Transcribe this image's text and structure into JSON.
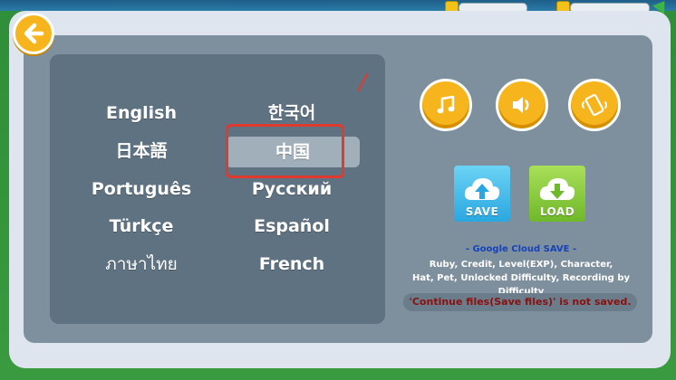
{
  "languages": {
    "english": "English",
    "korean": "한국어",
    "japanese": "日本語",
    "chinese": "中国",
    "portuguese": "Português",
    "russian": "Русский",
    "turkish": "Türkçe",
    "spanish": "Español",
    "thai": "ภาษาไทย",
    "french": "French",
    "selected": "chinese"
  },
  "cloud": {
    "save_label": "SAVE",
    "load_label": "LOAD",
    "title": "- Google Cloud SAVE -",
    "desc_line1": "Ruby, Credit, Level(EXP), Character,",
    "desc_line2": "Hat, Pet, Unlocked Difficulty, Recording by Difficulty",
    "notice": "'Continue  files(Save files)' is not saved."
  },
  "icons": {
    "back": "back-arrow-icon",
    "music": "music-note-icon",
    "sound": "speaker-icon",
    "vibration": "vibrate-phone-icon",
    "save": "cloud-upload-icon",
    "load": "cloud-download-icon"
  },
  "colors": {
    "button_yellow": "#f7b51d",
    "highlight_red": "#e2392f",
    "save_blue": "#2aa7e0",
    "load_green": "#6fb82a",
    "title_blue": "#1643b9",
    "notice_red": "#8b1010"
  }
}
